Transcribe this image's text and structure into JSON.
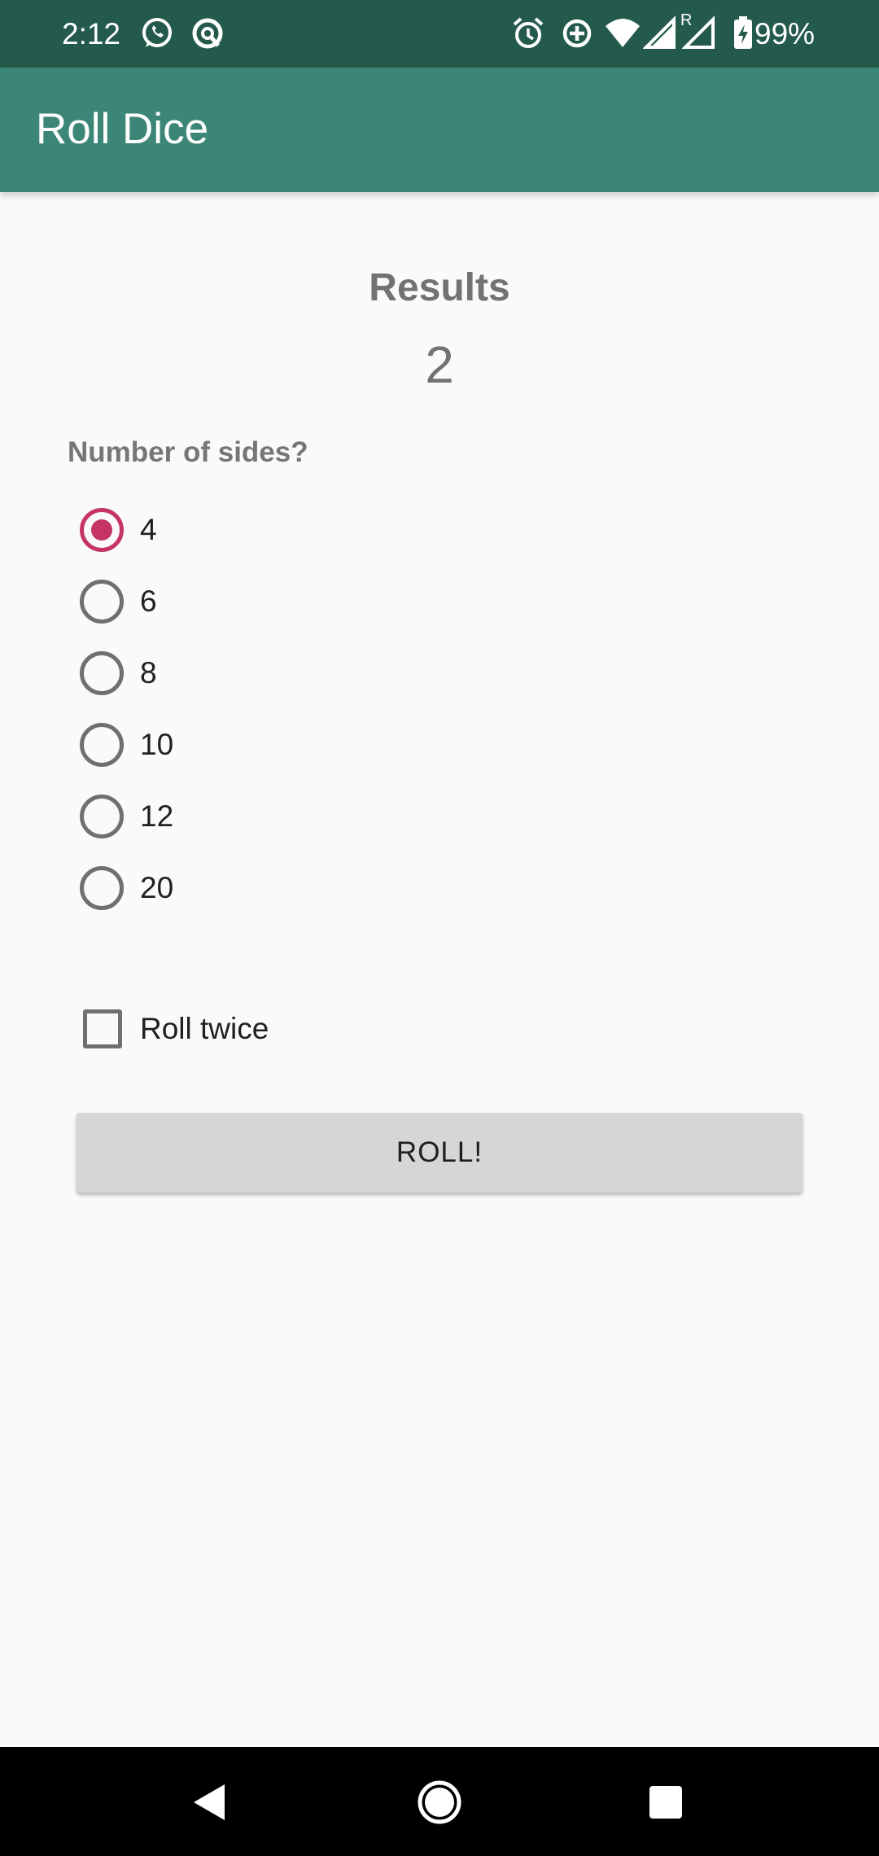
{
  "status_bar": {
    "time": "2:12",
    "battery": "99%",
    "left_icons": [
      "whatsapp-icon",
      "sync-icon"
    ],
    "right_icons": [
      "alarm-icon",
      "data-saver-icon",
      "wifi-icon",
      "signal-roaming-icon",
      "signal-icon",
      "battery-charging-icon"
    ],
    "roaming_indicator": "R"
  },
  "app_bar": {
    "title": "Roll Dice"
  },
  "results": {
    "title": "Results",
    "value": "2"
  },
  "sides": {
    "label": "Number of sides?",
    "options": [
      {
        "label": "4",
        "selected": true
      },
      {
        "label": "6",
        "selected": false
      },
      {
        "label": "8",
        "selected": false
      },
      {
        "label": "10",
        "selected": false
      },
      {
        "label": "12",
        "selected": false
      },
      {
        "label": "20",
        "selected": false
      }
    ]
  },
  "roll_twice": {
    "label": "Roll twice",
    "checked": false
  },
  "roll_button": {
    "label": "ROLL!"
  },
  "nav_bar": {
    "buttons": [
      "back-icon",
      "home-icon",
      "recents-icon"
    ]
  },
  "colors": {
    "status_bar": "#245A4C",
    "app_bar": "#3C8677",
    "accent": "#C53463",
    "background": "#FAFAFA",
    "button": "#D6D6D6"
  }
}
